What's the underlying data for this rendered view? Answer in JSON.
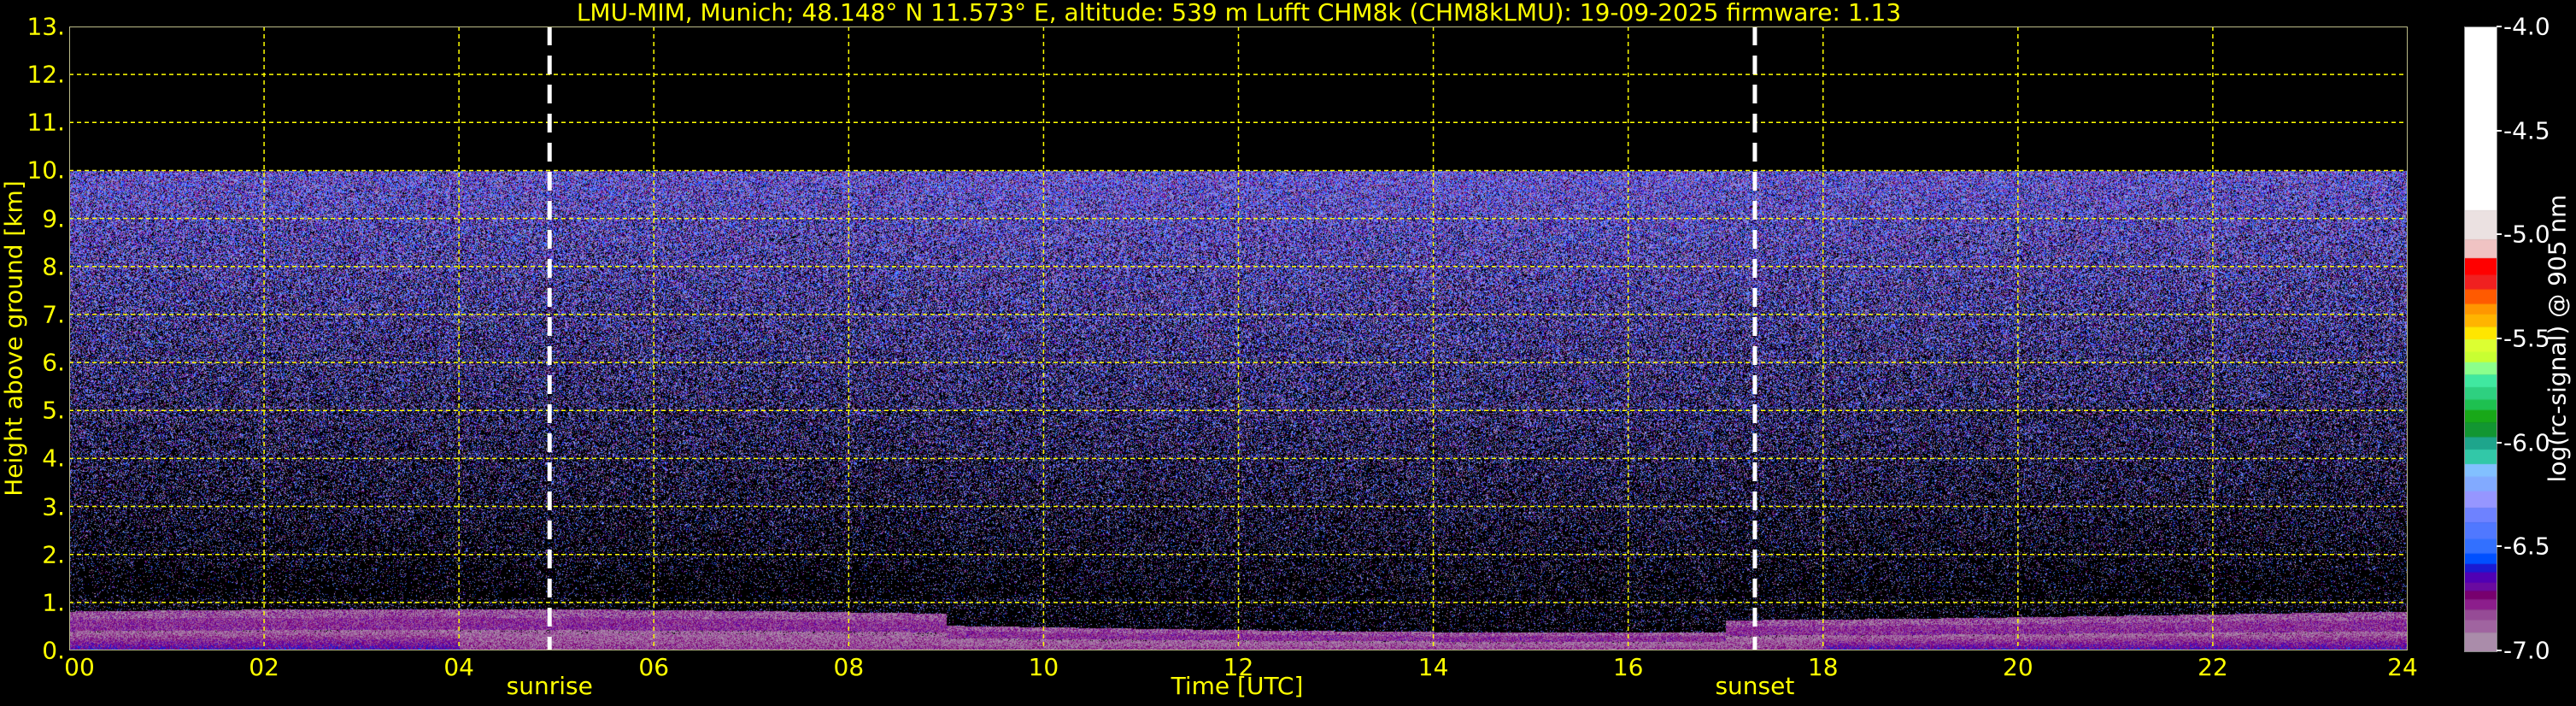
{
  "chart_data": {
    "type": "heatmap",
    "title": "LMU-MIM, Munich; 48.148° N 11.573° E, altitude: 539 m    Lufft CHM8k (CHM8kLMU): 19-09-2025    firmware: 1.13",
    "xlabel": "Time [UTC]",
    "ylabel": "Height above ground [km]",
    "xlim": [
      0,
      24
    ],
    "ylim": [
      0,
      13
    ],
    "x_ticks": [
      "00",
      "02",
      "04",
      "06",
      "08",
      "10",
      "12",
      "14",
      "16",
      "18",
      "20",
      "22",
      "24"
    ],
    "y_ticks": [
      "0.",
      "1.",
      "2.",
      "3.",
      "4.",
      "5.",
      "6.",
      "7.",
      "8.",
      "9.",
      "10.",
      "11.",
      "12.",
      "13."
    ],
    "grid": true,
    "grid_color": "#ffff00",
    "data_top_km": 10,
    "annotations": [
      {
        "label": "sunrise",
        "time_h": 4.93
      },
      {
        "label": "sunset",
        "time_h": 17.3
      }
    ],
    "colorbar": {
      "label": "log(rc-signal) @ 905 nm",
      "range": [
        -7.0,
        -4.0
      ],
      "ticks": [
        "-4.0",
        "-4.5",
        "-5.0",
        "-5.5",
        "-6.0",
        "-6.5",
        "-7.0"
      ],
      "boundaries": [
        -4.0,
        -4.88,
        -5.02,
        -5.11,
        -5.19,
        -5.26,
        -5.33,
        -5.38,
        -5.44,
        -5.5,
        -5.56,
        -5.61,
        -5.67,
        -5.73,
        -5.79,
        -5.84,
        -5.9,
        -5.97,
        -6.03,
        -6.1,
        -6.16,
        -6.23,
        -6.31,
        -6.38,
        -6.46,
        -6.53,
        -6.58,
        -6.62,
        -6.67,
        -6.71,
        -6.75,
        -6.8,
        -6.85,
        -6.91,
        -7.0
      ],
      "colors": [
        "#ffffff",
        "#ebe1e1",
        "#f0c3c3",
        "#ff0000",
        "#f02020",
        "#ff5a00",
        "#ff9600",
        "#ffb400",
        "#ffe600",
        "#dcff32",
        "#c8ff32",
        "#8cff8c",
        "#40e8a0",
        "#2ed080",
        "#1ec050",
        "#18a818",
        "#129632",
        "#1ea58c",
        "#32c8a8",
        "#82c0ff",
        "#82aaff",
        "#9696ff",
        "#6e82ff",
        "#5078ff",
        "#3270ff",
        "#0050ff",
        "#1a1ad2",
        "#5000b4",
        "#6a0aa0",
        "#78006e",
        "#8c1e8c",
        "#964b96",
        "#a064a0",
        "#aa8caa"
      ]
    }
  }
}
